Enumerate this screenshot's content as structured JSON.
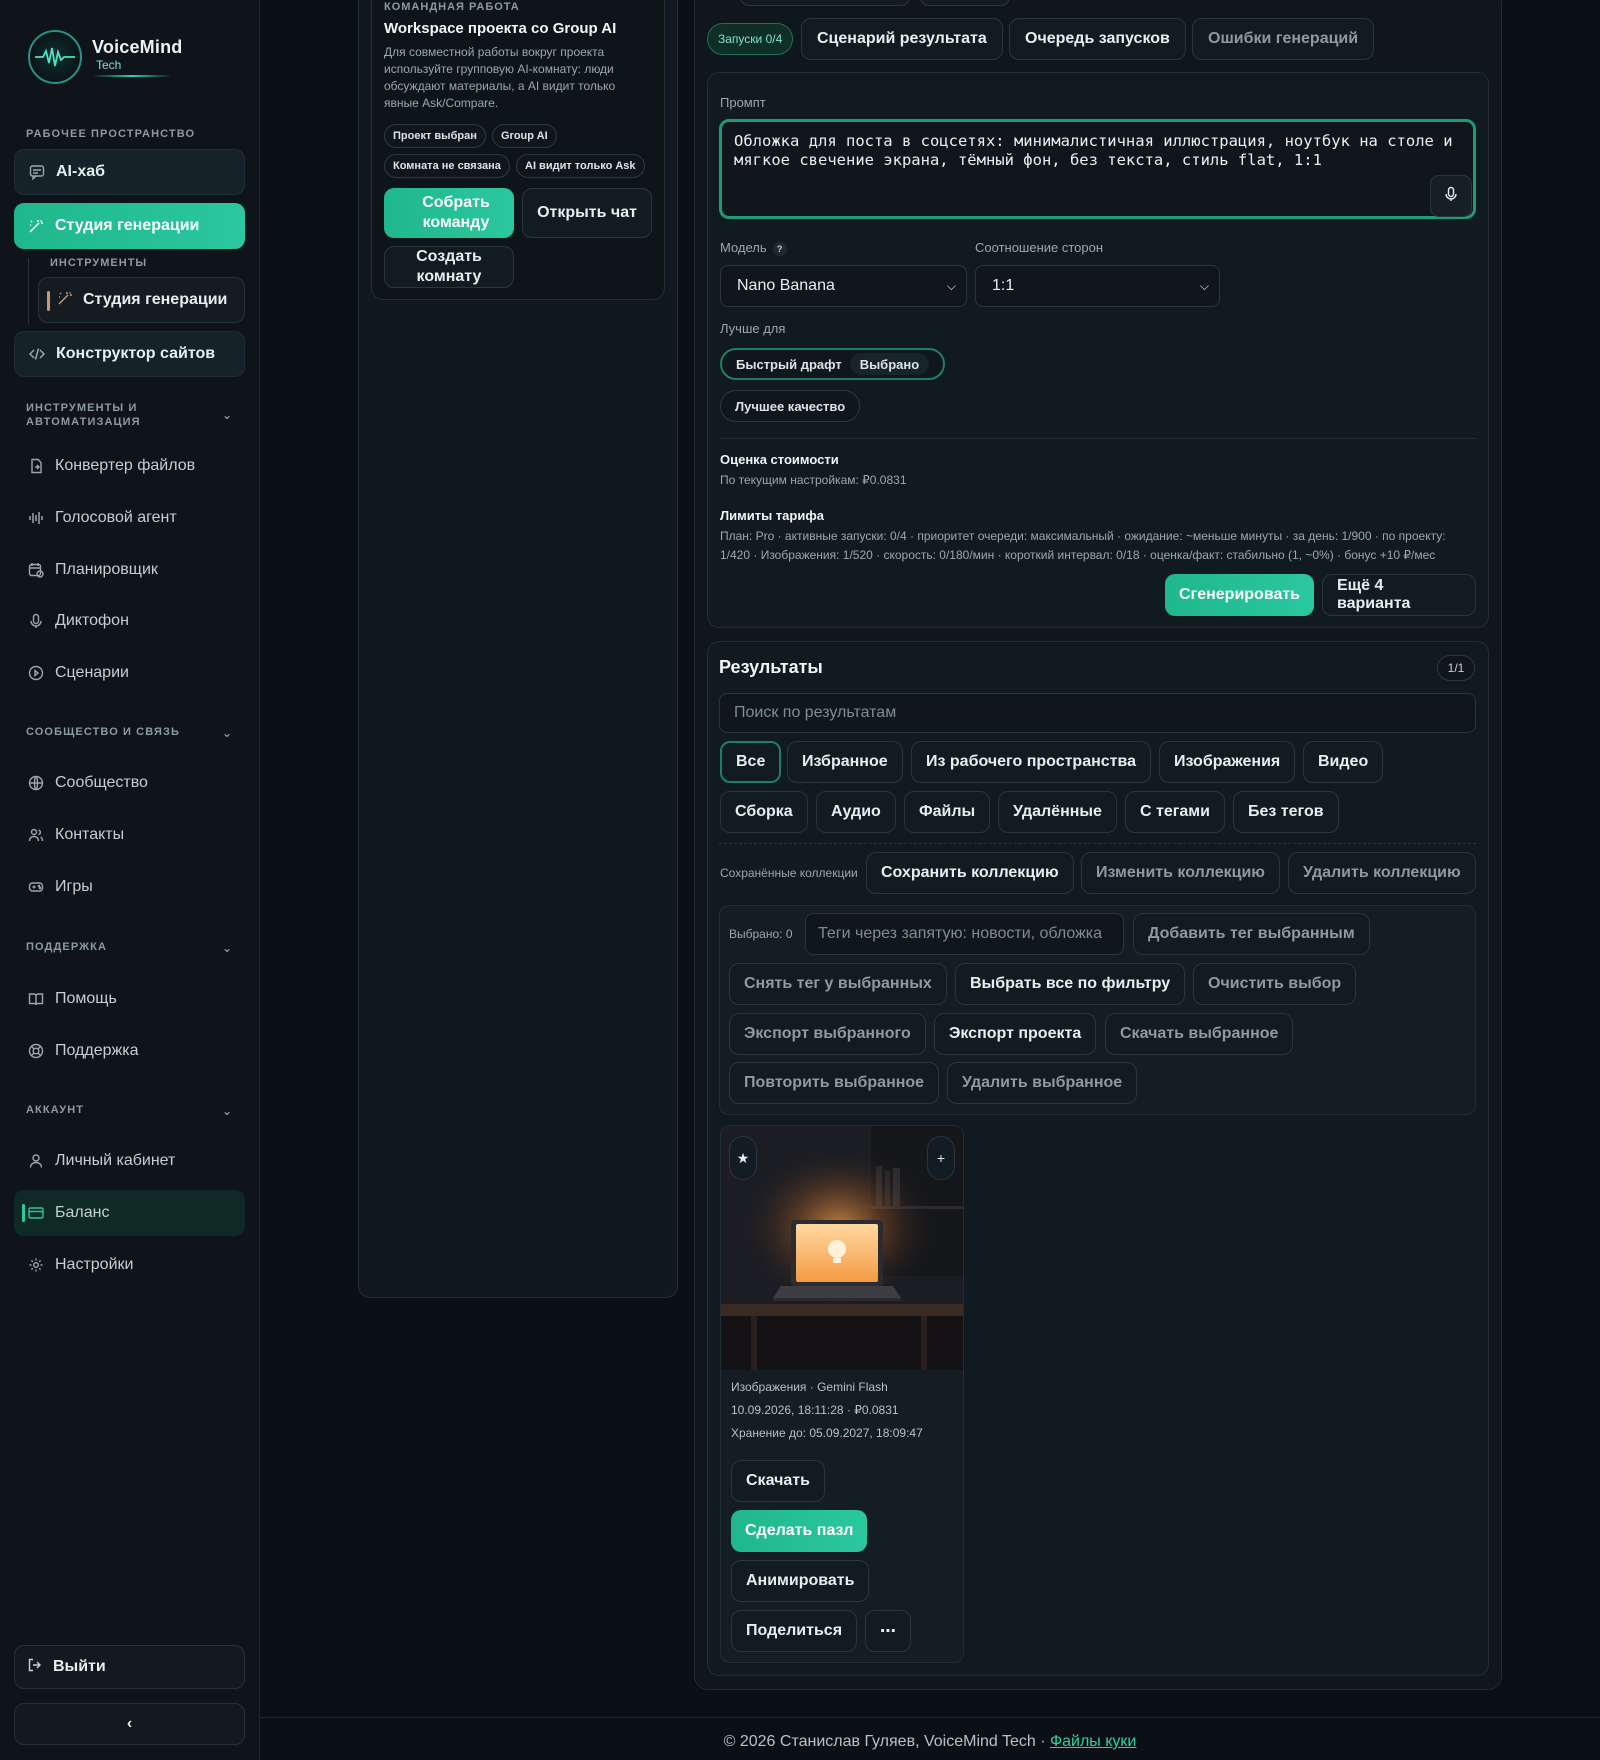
{
  "app": {
    "logo_name": "VoiceMind",
    "logo_sub": "Tech"
  },
  "sidebar": {
    "workspace_title": "Рабочее пространство",
    "ai_hub": "AI-хаб",
    "studio": "Студия генерации",
    "tools_sub_title": "ИНСТРУМЕНТЫ",
    "tools_sub_item": "Студия генерации",
    "site_builder": "Конструктор сайтов",
    "automation_title": "Инструменты и автоматизация",
    "automation_items": [
      "Конвертер файлов",
      "Голосовой агент",
      "Планировщик",
      "Диктофон",
      "Сценарии"
    ],
    "community_title": "Сообщество и связь",
    "community_items": [
      "Сообщество",
      "Контакты",
      "Игры"
    ],
    "support_title": "Поддержка",
    "support_items": [
      "Помощь",
      "Поддержка"
    ],
    "account_title": "Аккаунт",
    "account_items": [
      "Личный кабинет",
      "Баланс",
      "Настройки"
    ],
    "logout": "Выйти",
    "collapse": "‹"
  },
  "team": {
    "eyebrow": "КОМАНДНАЯ РАБОТА",
    "title": "Workspace проекта со Group AI",
    "desc": "Для совместной работы вокруг проекта используйте групповую AI-комнату: люди обсуждают материалы, а AI видит только явные Ask/Compare.",
    "chips": [
      "Проект выбран",
      "Group AI",
      "Комната не связана",
      "AI видит только Ask"
    ],
    "btn_assemble": "Собрать команду",
    "btn_open_chat": "Открыть чат",
    "btn_create_room": "Создать комнату"
  },
  "main": {
    "runs_badge": "Запуски 0/4",
    "tabs": [
      "Сценарий результата",
      "Очередь запусков",
      "Ошибки генераций"
    ],
    "prompt_label": "Промпт",
    "prompt_value": "Обложка для поста в соцсетях: минималистичная иллюстрация, ноутбук на столе и мягкое свечение экрана, тёмный фон, без текста, стиль flat, 1:1",
    "model_label": "Модель",
    "model_help": "?",
    "model_value": "Nano Banana",
    "aspect_label": "Соотношение сторон",
    "aspect_value": "1:1",
    "best_for_label": "Лучше для",
    "best_fast": "Быстрый драфт",
    "best_fast_badge": "Выбрано",
    "best_quality": "Лучшее качество",
    "cost_title": "Оценка стоимости",
    "cost_text": "По текущим настройкам: ₽0.0831",
    "limits_title": "Лимиты тарифа",
    "limits_line1": "План: Pro · активные запуски: 0/4 · приоритет очереди: максимальный · ожидание: ~меньше минуты · за день: 1/900 · по проекту:",
    "limits_line2": "1/420 · Изображения: 1/520 · скорость: 0/180/мин · короткий интервал: 0/18 · оценка/факт: стабильно (1, ~0%) · бонус +10 ₽/мес",
    "generate": "Сгенерировать",
    "more_variants": "Ещё 4 варианта"
  },
  "results": {
    "title": "Результаты",
    "count": "1/1",
    "search_placeholder": "Поиск по результатам",
    "filters_row1": [
      "Все",
      "Избранное",
      "Из рабочего пространства",
      "Изображения",
      "Видео"
    ],
    "filters_row2": [
      "Сборка",
      "Аудио",
      "Файлы",
      "Удалённые",
      "С тегами",
      "Без тегов"
    ],
    "collections_label": "Сохранённые коллекции",
    "save_collection": "Сохранить коллекцию",
    "edit_collection": "Изменить коллекцию",
    "delete_collection": "Удалить коллекцию",
    "selected_label": "Выбрано: 0",
    "tags_placeholder": "Теги через запятую: новости, обложка",
    "add_tag": "Добавить тег выбранным",
    "remove_tag": "Снять тег у выбранных",
    "select_all": "Выбрать все по фильтру",
    "clear_selection": "Очистить выбор",
    "export_selected": "Экспорт выбранного",
    "export_project": "Экспорт проекта",
    "download_selected": "Скачать выбранное",
    "repeat_selected": "Повторить выбранное",
    "delete_selected": "Удалить выбранное",
    "item": {
      "star": "★",
      "plus": "+",
      "meta1": "Изображения · Gemini Flash",
      "meta2": "10.09.2026, 18:11:28 · ₽0.0831",
      "meta3": "Хранение до: 05.09.2027, 18:09:47",
      "download": "Скачать",
      "puzzle": "Сделать пазл",
      "animate": "Анимировать",
      "share": "Поделиться",
      "more": "⋯"
    }
  },
  "footer": {
    "text": "© 2026 Станислав Гуляев, VoiceMind Tech · ",
    "link": "Файлы куки"
  },
  "colors": {
    "accent": "#2bc7a0",
    "background": "#0b1014",
    "panel": "#111a20"
  }
}
